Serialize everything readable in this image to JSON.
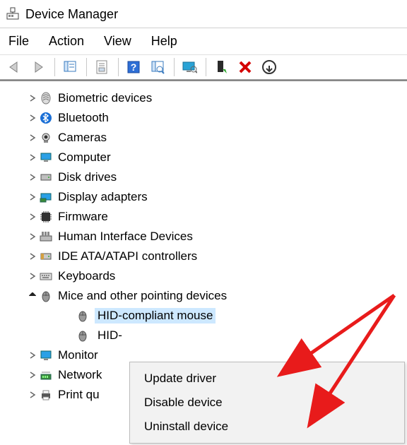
{
  "window": {
    "title": "Device Manager"
  },
  "menu": {
    "file": "File",
    "action": "Action",
    "view": "View",
    "help": "Help"
  },
  "toolbar_icons": {
    "back": "back-icon",
    "forward": "forward-icon",
    "show_hide": "show-hide-icon",
    "properties": "properties-icon",
    "help": "help-icon",
    "scan": "scan-icon",
    "monitor": "monitor-icon",
    "add": "add-hardware-icon",
    "remove": "remove-icon",
    "update": "update-icon"
  },
  "tree": {
    "items": [
      {
        "label": "Biometric devices",
        "icon": "biometric-icon",
        "expanded": false
      },
      {
        "label": "Bluetooth",
        "icon": "bluetooth-icon",
        "expanded": false
      },
      {
        "label": "Cameras",
        "icon": "camera-icon",
        "expanded": false
      },
      {
        "label": "Computer",
        "icon": "computer-icon",
        "expanded": false
      },
      {
        "label": "Disk drives",
        "icon": "disk-icon",
        "expanded": false
      },
      {
        "label": "Display adapters",
        "icon": "display-icon",
        "expanded": false
      },
      {
        "label": "Firmware",
        "icon": "firmware-icon",
        "expanded": false
      },
      {
        "label": "Human Interface Devices",
        "icon": "hid-icon",
        "expanded": false
      },
      {
        "label": "IDE ATA/ATAPI controllers",
        "icon": "ide-icon",
        "expanded": false
      },
      {
        "label": "Keyboards",
        "icon": "keyboard-icon",
        "expanded": false
      },
      {
        "label": "Mice and other pointing devices",
        "icon": "mouse-icon",
        "expanded": true,
        "children": [
          {
            "label": "HID-compliant mouse",
            "icon": "mouse-icon",
            "selected": true
          },
          {
            "label": "HID-",
            "icon": "mouse-icon",
            "selected": false
          }
        ]
      },
      {
        "label": "Monitor",
        "icon": "monitor-cat-icon",
        "expanded": false,
        "truncated": true
      },
      {
        "label": "Network",
        "icon": "network-icon",
        "expanded": false,
        "truncated": true
      },
      {
        "label": "Print qu",
        "icon": "printer-icon",
        "expanded": false,
        "truncated": true
      }
    ]
  },
  "context_menu": {
    "items": [
      {
        "label": "Update driver"
      },
      {
        "label": "Disable device"
      },
      {
        "label": "Uninstall device"
      }
    ]
  }
}
